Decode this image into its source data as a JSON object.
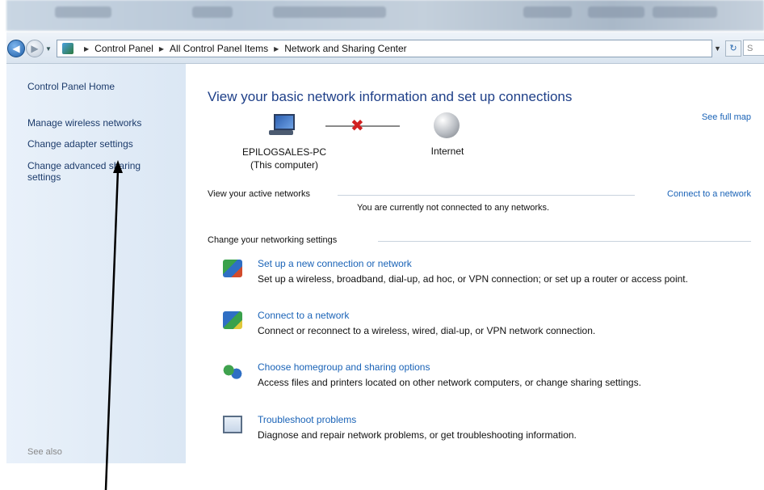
{
  "address_bar": {
    "crumbs": [
      "Control Panel",
      "All Control Panel Items",
      "Network and Sharing Center"
    ],
    "search_stub": "S"
  },
  "left_pane": {
    "links": [
      "Control Panel Home",
      "Manage wireless networks",
      "Change adapter settings",
      "Change advanced sharing",
      "settings"
    ],
    "see_also": "See also"
  },
  "main": {
    "title": "View your basic network information and set up connections",
    "see_full_map": "See full map",
    "computer_name": "EPILOGSALES-PC",
    "computer_sub": "(This computer)",
    "internet_label": "Internet",
    "active_networks_label": "View your active networks",
    "connect_link": "Connect to a network",
    "not_connected_text": "You are currently not connected to any networks.",
    "change_settings_label": "Change your networking settings",
    "tasks": [
      {
        "icon": "new-connection-icon",
        "title": "Set up a new connection or network",
        "desc": "Set up a wireless, broadband, dial-up, ad hoc, or VPN connection; or set up a router or access point."
      },
      {
        "icon": "connect-network-icon",
        "title": "Connect to a network",
        "desc": "Connect or reconnect to a wireless, wired, dial-up, or VPN network connection."
      },
      {
        "icon": "homegroup-icon",
        "title": "Choose homegroup and sharing options",
        "desc": "Access files and printers located on other network computers, or change sharing settings."
      },
      {
        "icon": "troubleshoot-icon",
        "title": "Troubleshoot problems",
        "desc": "Diagnose and repair network problems, or get troubleshooting information."
      }
    ]
  },
  "colors": {
    "link": "#1a63b7",
    "title": "#1e3f88",
    "left_pane_bg": "#e4edf8",
    "error_x": "#d12020"
  }
}
